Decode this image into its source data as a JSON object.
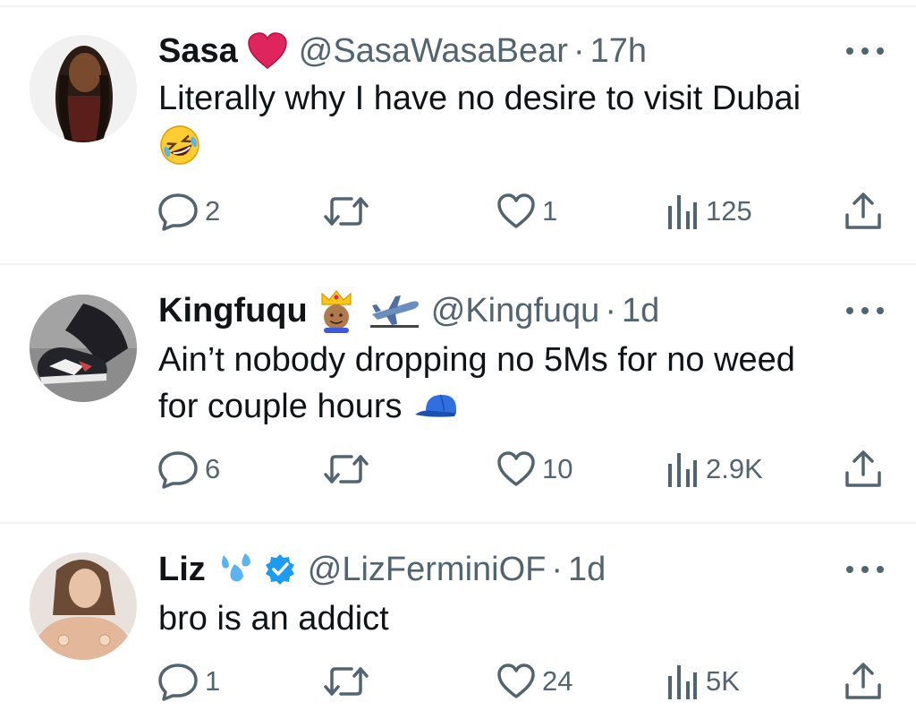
{
  "tweets": [
    {
      "name": "Sasa",
      "handle": "@SasaWasaBear",
      "dot": "·",
      "time": "17h",
      "text": "Literally why I have no desire to visit Dubai",
      "emoji": "🤣",
      "replies": "2",
      "likes": "1",
      "views": "125"
    },
    {
      "name": "Kingfuqu",
      "handle": "@Kingfuqu",
      "dot": "·",
      "time": "1d",
      "text_line1": "Ain’t nobody dropping no 5Ms for no weed",
      "text_line2": "for couple hours",
      "replies": "6",
      "likes": "10",
      "views": "2.9K"
    },
    {
      "name": "Liz",
      "handle": "@LizFerminiOF",
      "dot": "·",
      "time": "1d",
      "text": "bro is an addict",
      "replies": "1",
      "likes": "24",
      "views": "5K"
    }
  ],
  "icons": {
    "reply": "speech-bubble-icon",
    "retweet": "retweet-arrows-icon",
    "like": "heart-outline-icon",
    "views": "bar-chart-icon",
    "share": "share-upload-icon",
    "more": "ellipsis-icon"
  },
  "colors": {
    "text": "#0f1419",
    "secondary": "#536471",
    "divider": "#eff3f4",
    "verified": "#1d9bf0",
    "heart_red": "#e0245e"
  }
}
